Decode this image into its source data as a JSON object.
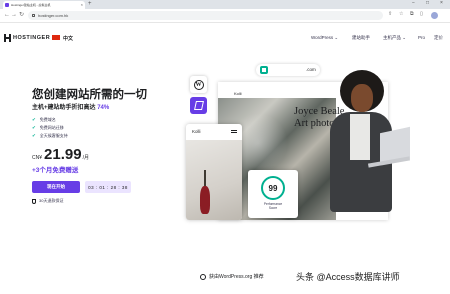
{
  "browser": {
    "tab_title": "Hostinger建站主机 - 虚拟主机",
    "tab_close": "×",
    "new_tab": "+",
    "url": "hostinger.com.hk",
    "back": "←",
    "forward": "→",
    "reload": "↻",
    "window_min": "−",
    "window_max": "□",
    "window_close": "×"
  },
  "nav": {
    "logo": "HOSTINGER",
    "language": "中文",
    "items": [
      "WordPress ⌄",
      "建站助手",
      "主机产品 ⌄",
      "Pro",
      "定价"
    ]
  },
  "hero": {
    "title": "您创建网站所需的一切",
    "subtitle_prefix": "主机+建站助手折扣高达",
    "subtitle_pct": "74%",
    "features": [
      "免费域名",
      "免费网站迁移",
      "全天候客服支持"
    ],
    "currency": "CN¥",
    "price": "21.99",
    "period": "/月",
    "bonus": "+3个月免费赠送",
    "cta": "现在开始",
    "timer": "03 : 01 : 28 : 38",
    "guarantee": "30天退款保证"
  },
  "visual": {
    "domain": ".com",
    "card_brand": "Kolli",
    "card_name_line1": "Joyce Beale,",
    "card_name_line2": "Art photograph",
    "phone_brand": "Kolli",
    "score": "99",
    "score_label_line1": "Performance",
    "score_label_line2": "Score"
  },
  "footer": {
    "endorse": "获由WordPress.org 推荐"
  },
  "watermark": "头条 @Access数据库讲师",
  "colors": {
    "brand": "#673de6",
    "accent_green": "#00b090",
    "text": "#1d1e20"
  }
}
